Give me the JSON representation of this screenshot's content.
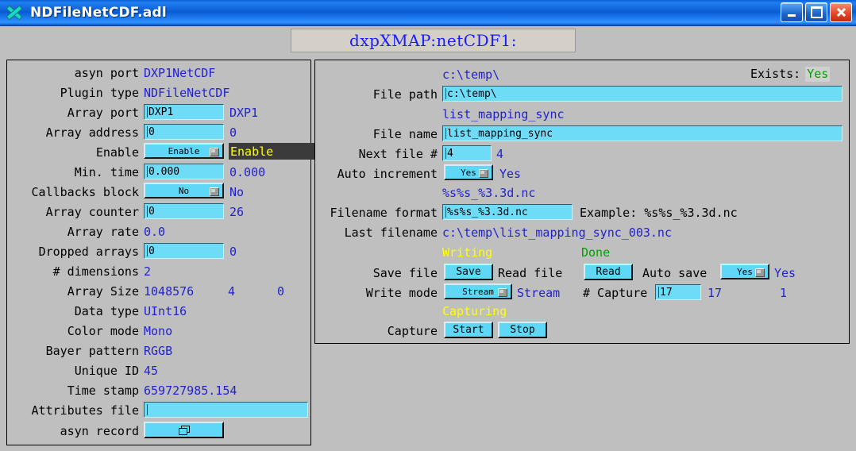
{
  "window": {
    "title": "NDFileNetCDF.adl",
    "icon": "x-logo-icon",
    "buttons": {
      "minimize": "–",
      "maximize": "□",
      "close": "✕"
    }
  },
  "banner": {
    "title": "dxpXMAP:netCDF1:"
  },
  "left_panel": {
    "rows": [
      {
        "label": "asyn port",
        "readback": "DXP1NetCDF"
      },
      {
        "label": "Plugin type",
        "readback": "NDFileNetCDF"
      },
      {
        "label": "Array port",
        "entry": "DXP1",
        "readback": "DXP1"
      },
      {
        "label": "Array address",
        "entry": "0",
        "readback": "0"
      },
      {
        "label": "Enable",
        "menu": "Enable",
        "highlight": "Enable"
      },
      {
        "label": "Min. time",
        "entry": "0.000",
        "readback": "0.000"
      },
      {
        "label": "Callbacks block",
        "menu": "No",
        "readback": "No"
      },
      {
        "label": "Array counter",
        "entry": "0",
        "readback": "26"
      },
      {
        "label": "Array rate",
        "readback": "0.0"
      },
      {
        "label": "Dropped arrays",
        "entry": "0",
        "readback": "0"
      },
      {
        "label": "# dimensions",
        "readback": "2"
      },
      {
        "label": "Array Size",
        "readback": "1048576",
        "readback2": "4",
        "readback3": "0"
      },
      {
        "label": "Data type",
        "readback": "UInt16"
      },
      {
        "label": "Color mode",
        "readback": "Mono"
      },
      {
        "label": "Bayer pattern",
        "readback": "RGGB"
      },
      {
        "label": "Unique ID",
        "readback": "45"
      },
      {
        "label": "Time stamp",
        "readback": "659727985.154"
      },
      {
        "label": "Attributes file",
        "entry": ""
      },
      {
        "label": "asyn record",
        "button_icon": "related-display-icon"
      }
    ]
  },
  "right_panel": {
    "exists_label": "Exists:",
    "exists_value": "Yes",
    "file_path_readback": "c:\\temp\\",
    "file_path_label": "File path",
    "file_path_entry": "c:\\temp\\",
    "file_name_readback": "list_mapping_sync",
    "file_name_label": "File name",
    "file_name_entry": "list_mapping_sync",
    "next_file_label": "Next file #",
    "next_file_entry": "4",
    "next_file_readback": "4",
    "auto_increment_label": "Auto increment",
    "auto_increment_menu": "Yes",
    "auto_increment_readback": "Yes",
    "filename_format_readback": "%s%s_%3.3d.nc",
    "filename_format_label": "Filename format",
    "filename_format_entry": "%s%s_%3.3d.nc",
    "filename_example_label": "Example: %s%s_%3.3d.nc",
    "last_filename_label": "Last filename",
    "last_filename_readback": "c:\\temp\\list_mapping_sync_003.nc",
    "write_status": "Writing",
    "read_status": "Done",
    "save_file_label": "Save file",
    "save_button": "Save",
    "read_file_label": "Read file",
    "read_button": "Read",
    "auto_save_label": "Auto save",
    "auto_save_menu": "Yes",
    "auto_save_readback": "Yes",
    "write_mode_label": "Write mode",
    "write_mode_menu": "Stream",
    "write_mode_readback": "Stream",
    "num_capture_label": "# Capture",
    "num_capture_entry": "17",
    "num_capture_readback": "17",
    "num_captured_readback": "1",
    "capture_status": "Capturing",
    "capture_label": "Capture",
    "capture_start": "Start",
    "capture_stop": "Stop"
  },
  "colors": {
    "readback_blue": "#2222cc",
    "status_yellow": "#ffff00",
    "status_green": "#00a000",
    "widget_cyan": "#5fd8f7",
    "panel_gray": "#bfbfbf",
    "title_blue": "#0a5ad0"
  }
}
